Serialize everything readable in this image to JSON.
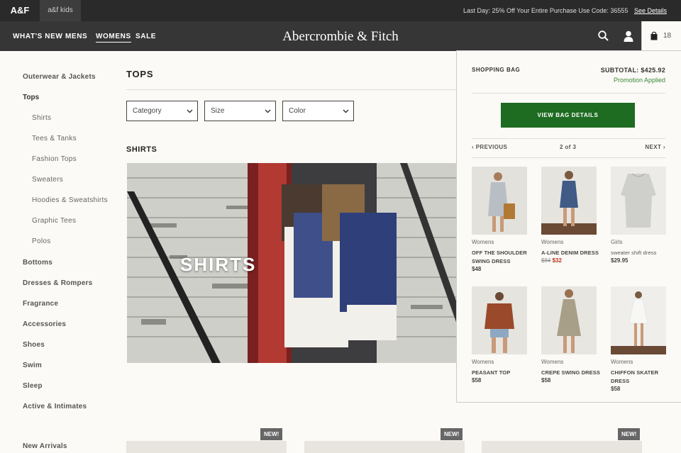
{
  "topbar": {
    "brand": "A&F",
    "kids": "a&f kids",
    "promo": "Last Day: 25% Off Your Entire Purchase  Use Code: 36555",
    "see_details": "See Details"
  },
  "nav": {
    "items": [
      "WHAT'S NEW",
      "MENS",
      "WOMENS",
      "SALE"
    ],
    "logo": "Abercrombie & Fitch",
    "bag_count": "18"
  },
  "sidebar": {
    "items": [
      "Outerwear & Jackets",
      "Tops",
      "Shirts",
      "Tees & Tanks",
      "Fashion Tops",
      "Sweaters",
      "Hoodies & Sweatshirts",
      "Graphic Tees",
      "Polos",
      "Bottoms",
      "Dresses & Rompers",
      "Fragrance",
      "Accessories",
      "Shoes",
      "Swim",
      "Sleep",
      "Active & Intimates",
      "New Arrivals"
    ]
  },
  "content": {
    "title": "TOPS",
    "filters": [
      "Category",
      "Size",
      "Color"
    ],
    "section": "SHIRTS",
    "hero_text": "SHIRTS",
    "new_badge": "NEW!"
  },
  "bag": {
    "title": "SHOPPING BAG",
    "subtotal": "SUBTOTAL: $425.92",
    "promo": "Promotion Applied",
    "cta": "VIEW BAG DETAILS",
    "previous": "PREVIOUS",
    "page": "2 of 3",
    "next": "NEXT",
    "items": [
      {
        "category": "Womens",
        "name": "OFF THE SHOULDER SWING DRESS",
        "price": "$48"
      },
      {
        "category": "Womens",
        "name": "A-LINE DENIM DRESS",
        "price_old": "$84",
        "price": "$32"
      },
      {
        "category": "Girls",
        "name": "sweater shift dress",
        "price": "$29.95"
      },
      {
        "category": "Womens",
        "name": "PEASANT TOP",
        "price": "$58"
      },
      {
        "category": "Womens",
        "name": "CREPE SWING DRESS",
        "price": "$58"
      },
      {
        "category": "Womens",
        "name": "CHIFFON SKATER DRESS",
        "price": "$58"
      }
    ]
  }
}
